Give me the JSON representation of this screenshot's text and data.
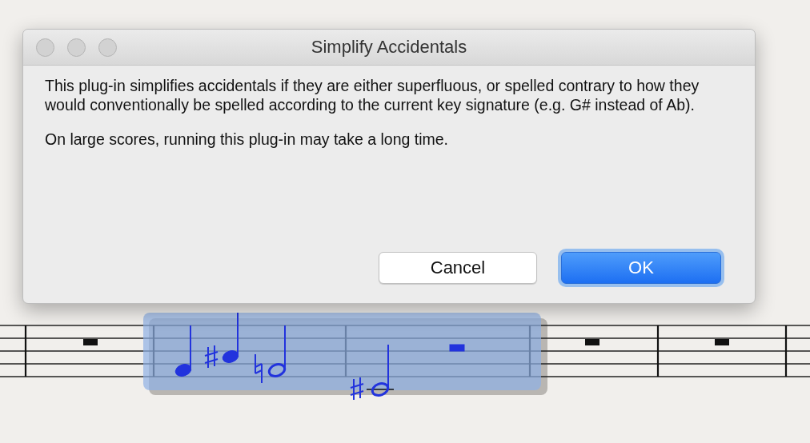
{
  "dialog": {
    "title": "Simplify Accidentals",
    "paragraphs": [
      "This plug-in simplifies accidentals if they are either superfluous, or spelled contrary to how they would conventionally be spelled according to the current key signature (e.g. G# instead of Ab).",
      "On large scores, running this plug-in may take a long time."
    ],
    "buttons": [
      {
        "label": "Cancel",
        "kind": "normal"
      },
      {
        "label": "OK",
        "kind": "default"
      }
    ]
  }
}
